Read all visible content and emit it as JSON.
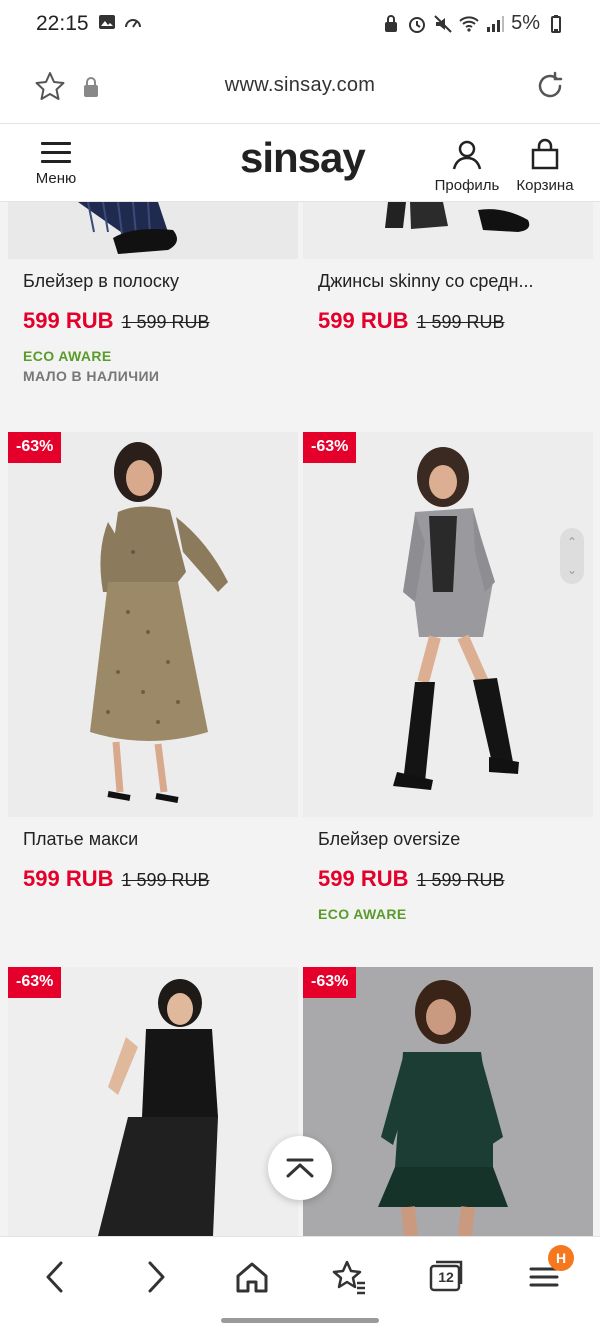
{
  "status_bar": {
    "time": "22:15",
    "battery": "5%"
  },
  "browser": {
    "url": "www.sinsay.com",
    "tab_count": "12",
    "notification_badge": "Н"
  },
  "header": {
    "menu_label": "Меню",
    "logo": "sinsay",
    "profile_label": "Профиль",
    "cart_label": "Корзина"
  },
  "products": [
    {
      "name": "Блейзер в полоску",
      "price": "599 RUB",
      "old_price": "1 599 RUB",
      "tags": [
        "ECO AWARE",
        "МАЛО В НАЛИЧИИ"
      ]
    },
    {
      "name": "Джинсы skinny со средн...",
      "price": "599 RUB",
      "old_price": "1 599 RUB",
      "tags": []
    },
    {
      "badge": "-63%",
      "name": "Платье макси",
      "price": "599 RUB",
      "old_price": "1 599 RUB",
      "tags": []
    },
    {
      "badge": "-63%",
      "name": "Блейзер oversize",
      "price": "599 RUB",
      "old_price": "1 599 RUB",
      "tags": [
        "ECO AWARE"
      ]
    },
    {
      "badge": "-63%"
    },
    {
      "badge": "-63%"
    }
  ],
  "colors": {
    "sale_red": "#e4002b",
    "eco_green": "#5a9c2b",
    "badge_orange": "#f5781e"
  },
  "icons": [
    "star-icon",
    "lock-icon",
    "reload-icon",
    "menu-icon",
    "user-icon",
    "bag-icon",
    "back-icon",
    "forward-icon",
    "home-icon",
    "bookmarks-icon",
    "tabs-icon",
    "browser-menu-icon",
    "scroll-to-top-icon"
  ]
}
